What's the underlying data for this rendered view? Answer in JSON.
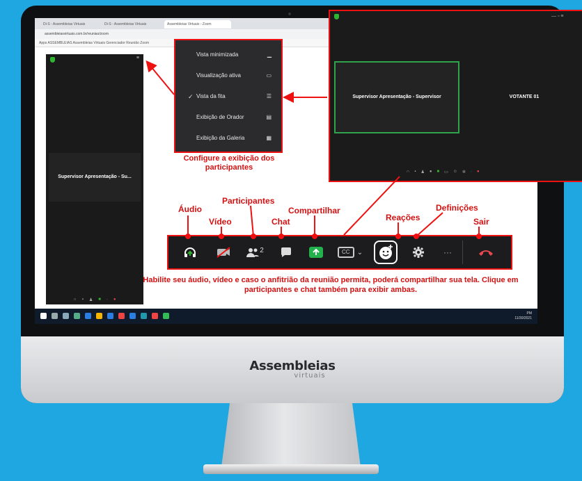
{
  "browser": {
    "tabs": [
      "Di-S - Assembleias Virtuais",
      "Di-S - Assembleias Virtuais",
      "Assembleias Virtuais - Zoom"
    ],
    "address": "assembleiasvirtuais.com.br/reuniao/zoom",
    "bookmarks": "Apps  ASSEMBLEIAS  Assembleias Virtuais  Gerenciador  Reunião  Zoom"
  },
  "zoom_left": {
    "video_name": "Supervisor Apresentação - Su..."
  },
  "menu": {
    "items": [
      {
        "label": "Vista minimizada",
        "icon": "▁"
      },
      {
        "label": "Visualização ativa",
        "icon": "▭"
      },
      {
        "label": "Vista da fita",
        "icon": "☰",
        "checked": true,
        "check": "✓"
      },
      {
        "label": "Exibição de Orador",
        "icon": "▤"
      },
      {
        "label": "Exibição da Galeria",
        "icon": "▦"
      }
    ],
    "caption": "Configure a exibição dos participantes"
  },
  "zoom_popup": {
    "participant_1": "Supervisor Apresentação - Supervisor",
    "participant_2": "VOTANTE 01"
  },
  "labels": {
    "audio": "Áudio",
    "video": "Vídeo",
    "participants": "Participantes",
    "chat": "Chat",
    "share": "Compartilhar",
    "reactions": "Reações",
    "settings": "Definições",
    "leave": "Sair"
  },
  "toolbar": {
    "participant_count": "2",
    "cc_label": "CC",
    "more_label": "···"
  },
  "caption_bottom": "Habilite seu áudio, vídeo e caso o anfitrião da reunião permita, poderá compartilhar sua tela. Clique em participantes e chat também para exibir ambas.",
  "taskbar": {
    "time": "PM",
    "date": "11/30/2021"
  },
  "brand": {
    "main": "Assembleias",
    "sub": "virtuais"
  },
  "colors": {
    "background": "#1ea7e1",
    "highlight": "#e11111",
    "label_red": "#d41111",
    "share_green": "#23b14d",
    "leave_red": "#e5484d"
  }
}
